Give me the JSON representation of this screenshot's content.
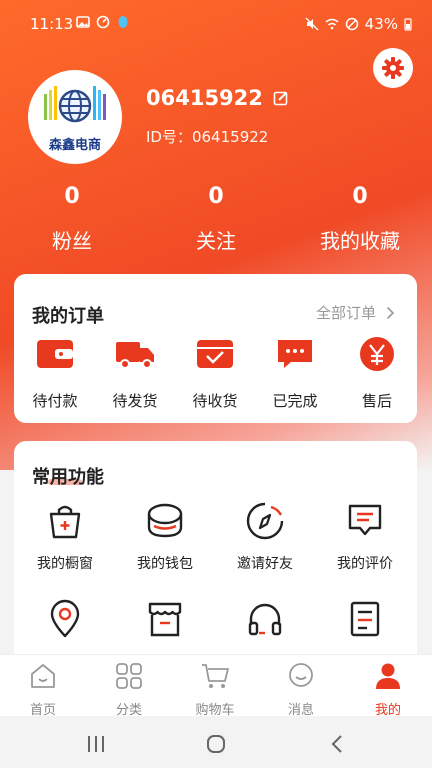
{
  "status": {
    "time": "11:13",
    "battery": "43%"
  },
  "profile": {
    "logo_text": "森鑫电商",
    "username": "06415922",
    "id_label": "ID号：06415922"
  },
  "stats": [
    {
      "value": "0",
      "label": "粉丝"
    },
    {
      "value": "0",
      "label": "关注"
    },
    {
      "value": "0",
      "label": "我的收藏"
    }
  ],
  "orders": {
    "title": "我的订单",
    "all_label": "全部订单",
    "items": [
      {
        "label": "待付款",
        "icon": "wallet-icon"
      },
      {
        "label": "待发货",
        "icon": "truck-icon"
      },
      {
        "label": "待收货",
        "icon": "receive-icon"
      },
      {
        "label": "已完成",
        "icon": "chat-done-icon"
      },
      {
        "label": "售后",
        "icon": "yen-icon"
      }
    ]
  },
  "tools": {
    "title": "常用功能",
    "items": [
      {
        "label": "我的橱窗",
        "icon": "shop-bag-icon"
      },
      {
        "label": "我的钱包",
        "icon": "wallet-coins-icon"
      },
      {
        "label": "邀请好友",
        "icon": "compass-icon"
      },
      {
        "label": "我的评价",
        "icon": "comment-icon"
      },
      {
        "label": "",
        "icon": "location-icon"
      },
      {
        "label": "",
        "icon": "store-icon"
      },
      {
        "label": "",
        "icon": "headset-icon"
      },
      {
        "label": "",
        "icon": "document-icon"
      }
    ]
  },
  "tabbar": [
    {
      "label": "首页",
      "icon": "home-icon"
    },
    {
      "label": "分类",
      "icon": "category-icon"
    },
    {
      "label": "购物车",
      "icon": "cart-icon"
    },
    {
      "label": "消息",
      "icon": "message-icon"
    },
    {
      "label": "我的",
      "icon": "profile-icon"
    }
  ],
  "colors": {
    "accent": "#e8391f",
    "hero_start": "#ff6a2a",
    "hero_end": "#f04a26"
  }
}
